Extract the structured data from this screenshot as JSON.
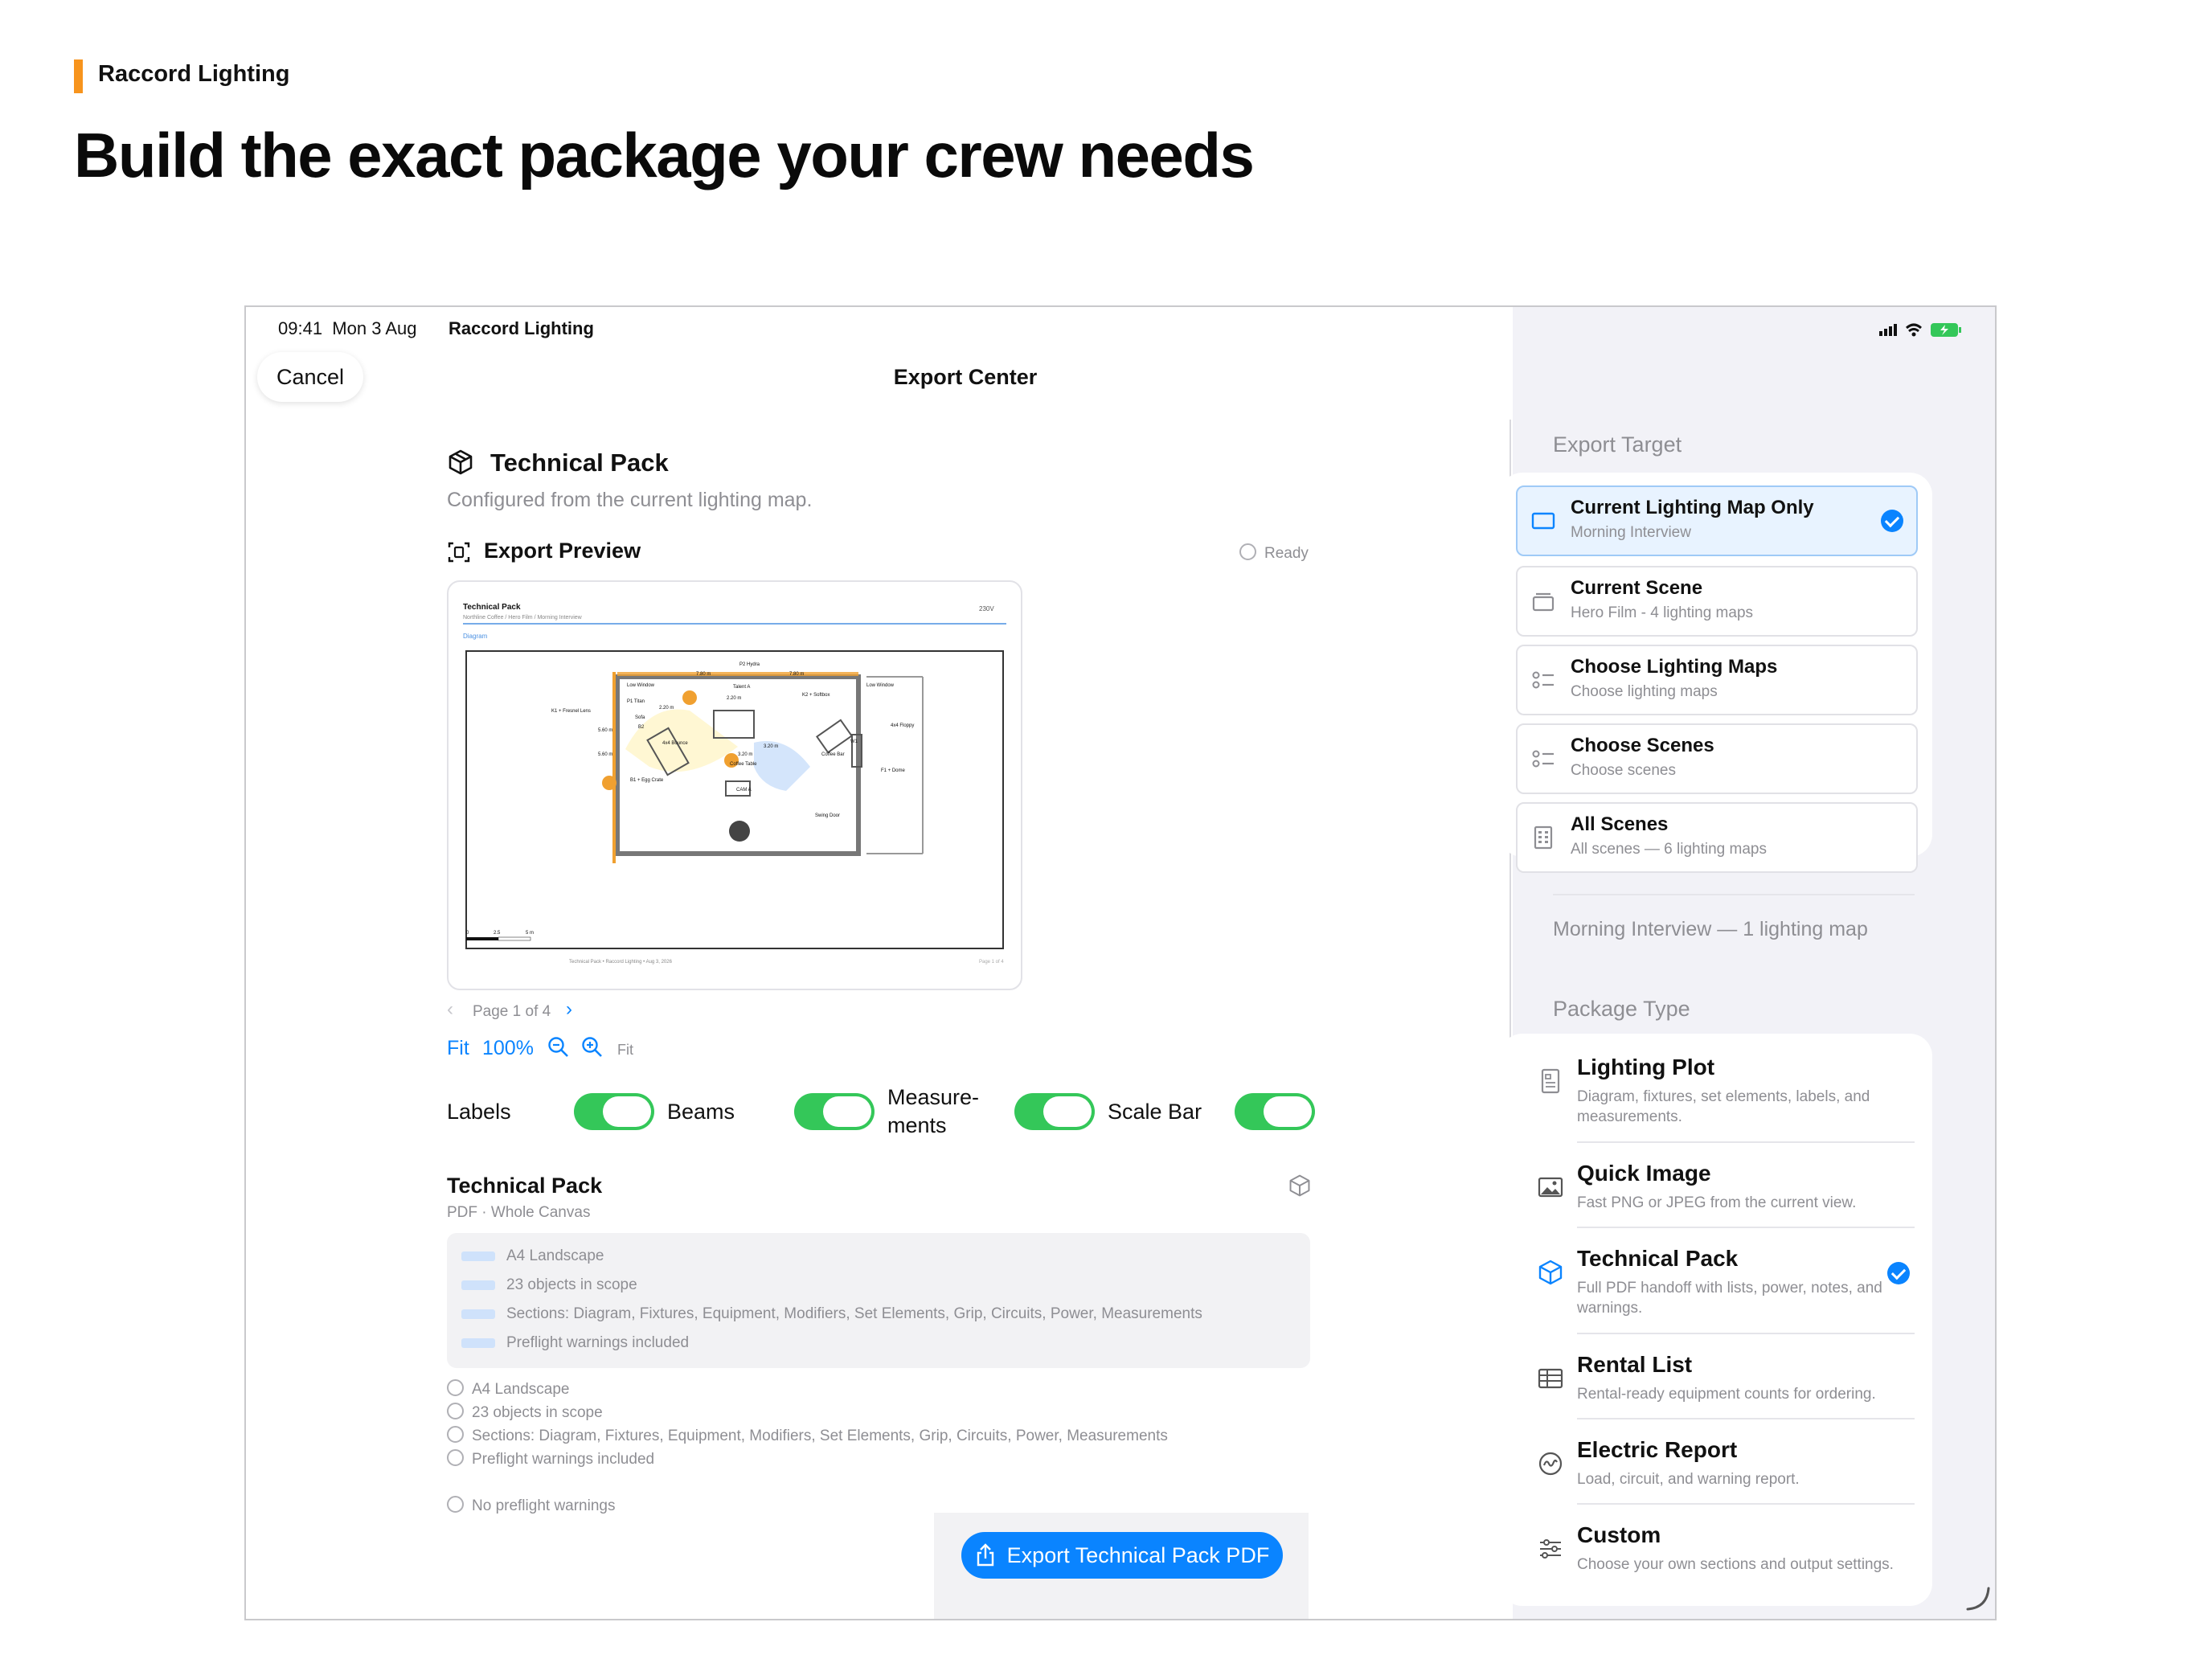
{
  "brand": {
    "name": "Raccord Lighting",
    "accent": "#f7941d"
  },
  "headline": "Build the exact package your crew needs",
  "status": {
    "time": "09:41",
    "date": "Mon 3 Aug",
    "app": "Raccord Lighting"
  },
  "nav": {
    "cancel": "Cancel",
    "title": "Export Center"
  },
  "main": {
    "pack_title": "Technical Pack",
    "pack_subtitle": "Configured from the current lighting map.",
    "preview_title": "Export Preview",
    "preview_status": "Ready",
    "preview_doc": {
      "title": "Technical Pack",
      "subtitle": "Northline Coffee / Hero Film / Morning Interview",
      "voltage": "230V",
      "section": "Diagram",
      "labels": [
        "P2 Hydra",
        "7.80 m",
        "7.80 m",
        "Low Window",
        "Talent A",
        "Low Window",
        "2.20 m",
        "K2 + Softbox",
        "P1 Titan",
        "2.20 m",
        "K1 + Fresnel Lens",
        "Sofa",
        "4x4 Floppy",
        "B2",
        "5.60 m",
        "5.60 m",
        "4x4 Bounce",
        "3.20 m",
        "W1",
        "Coffee Bar",
        "3.20 m",
        "Coffee Table",
        "F1 + Dome",
        "B1 + Egg Crate",
        "CAM A",
        "Swing Door"
      ],
      "scale": [
        "0",
        "2.5",
        "5 m"
      ],
      "footer": "Technical Pack • Raccord Lighting • Aug 3, 2026",
      "page": "Page 1 of 4"
    },
    "pager": "Page 1 of 4",
    "zoom": {
      "fit": "Fit",
      "level": "100%",
      "fit_small": "Fit"
    },
    "toggles": [
      {
        "label": "Labels",
        "on": true
      },
      {
        "label": "Beams",
        "on": true
      },
      {
        "label": "Measure-\nments",
        "on": true
      },
      {
        "label": "Scale Bar",
        "on": true
      }
    ],
    "summary_title": "Technical Pack",
    "summary_sub": "PDF · Whole Canvas",
    "summary_items": [
      "A4 Landscape",
      "23 objects in scope",
      "Sections: Diagram, Fixtures, Equipment, Modifiers, Set Elements, Grip, Circuits, Power, Measurements",
      "Preflight warnings included"
    ],
    "checks": [
      "A4 Landscape",
      "23 objects in scope",
      "Sections: Diagram, Fixtures, Equipment, Modifiers, Set Elements, Grip, Circuits, Power, Measurements",
      "Preflight warnings included"
    ],
    "preflight": "No preflight warnings",
    "export_button": "Export Technical Pack PDF"
  },
  "sidebar": {
    "target_label": "Export Target",
    "targets": [
      {
        "title": "Current Lighting Map Only",
        "sub": "Morning Interview",
        "selected": true,
        "icon": "rectangle-icon"
      },
      {
        "title": "Current Scene",
        "sub": "Hero Film - 4 lighting maps",
        "selected": false,
        "icon": "stack-icon"
      },
      {
        "title": "Choose Lighting Maps",
        "sub": "Choose lighting maps",
        "selected": false,
        "icon": "checklist-icon"
      },
      {
        "title": "Choose Scenes",
        "sub": "Choose scenes",
        "selected": false,
        "icon": "checklist-icon"
      },
      {
        "title": "All Scenes",
        "sub": "All scenes — 6 lighting maps",
        "selected": false,
        "icon": "building-icon"
      }
    ],
    "target_footer": "Morning Interview — 1 lighting map",
    "package_label": "Package Type",
    "packages": [
      {
        "title": "Lighting Plot",
        "sub": "Diagram, fixtures, set elements, labels, and measurements.",
        "selected": false,
        "icon": "document-icon"
      },
      {
        "title": "Quick Image",
        "sub": "Fast PNG or JPEG from the current view.",
        "selected": false,
        "icon": "photo-icon"
      },
      {
        "title": "Technical Pack",
        "sub": "Full PDF handoff with lists, power, notes, and warnings.",
        "selected": true,
        "icon": "cube-icon"
      },
      {
        "title": "Rental List",
        "sub": "Rental-ready equipment counts for ordering.",
        "selected": false,
        "icon": "table-icon"
      },
      {
        "title": "Electric Report",
        "sub": "Load, circuit, and warning report.",
        "selected": false,
        "icon": "waveform-icon"
      },
      {
        "title": "Custom",
        "sub": "Choose your own sections and output settings.",
        "selected": false,
        "icon": "sliders-icon"
      }
    ]
  },
  "colors": {
    "accent": "#0a84ff",
    "toggle": "#34c759",
    "sidebar_bg": "#f2f2f7"
  }
}
